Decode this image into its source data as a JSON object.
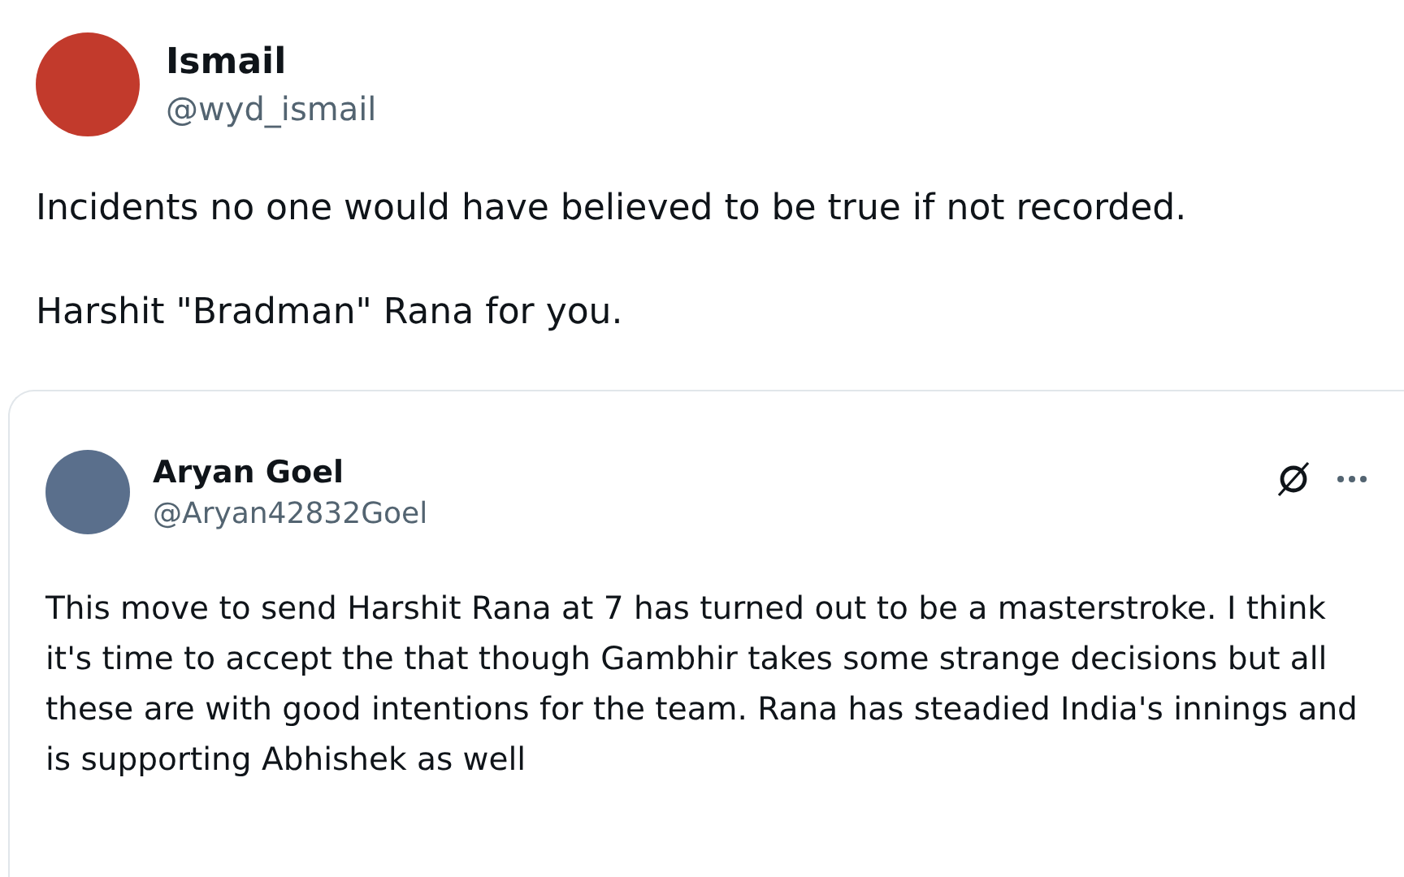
{
  "tweet": {
    "author": {
      "name": "Ismail",
      "handle": "@wyd_ismail"
    },
    "paragraphs": [
      "Incidents no one would have believed to be true if not recorded.",
      "Harshit \"Bradman\" Rana for you."
    ],
    "quoted_tweet": {
      "author": {
        "name": "Aryan Goel",
        "handle": "@Aryan42832Goel"
      },
      "text": "This move to send Harshit Rana at 7 has turned out to be a masterstroke. I think it's time to accept the that though Gambhir takes some strange decisions but all these are with good intentions for the team. Rana has steadied India's innings and is supporting Abhishek as well"
    }
  }
}
